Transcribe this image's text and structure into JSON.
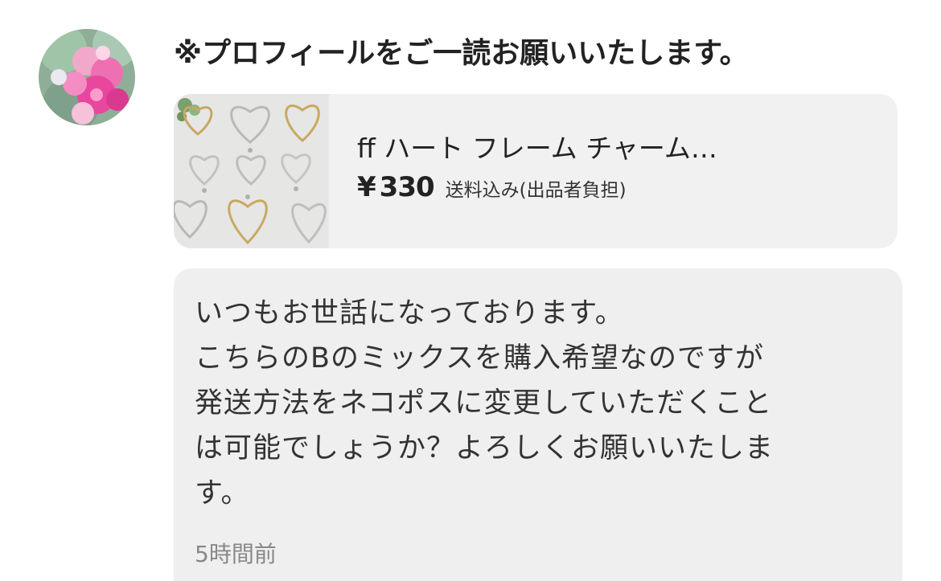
{
  "comment": {
    "username": "※プロフィールをご一読お願いいたします。",
    "avatar_icon": "flower-avatar-icon",
    "product": {
      "thumbnail_icon": "heart-frame-charm-photo",
      "name": "ff ハート フレーム チャーム…",
      "currency": "¥",
      "price": "330",
      "shipping": "送料込み(出品者負担)"
    },
    "message": "いつもお世話になっております。\nこちらのBのミックスを購入希望なのですが\n発送方法をネコポスに変更していただくこと\nは可能でしょうか？よろしくお願いいたしま\nす。",
    "timestamp": "5時間前"
  },
  "colors": {
    "card_bg": "#f1f1f1",
    "bubble_bg": "#efefef",
    "text": "#222222",
    "muted": "#888888"
  }
}
